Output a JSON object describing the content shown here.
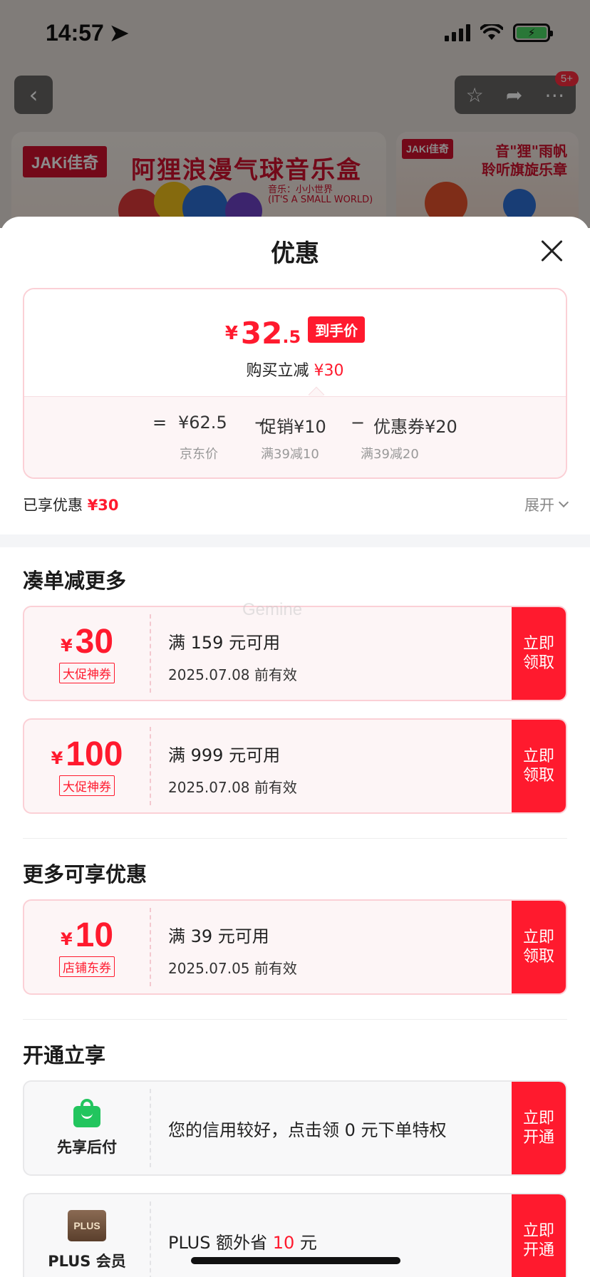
{
  "status": {
    "time": "14:57"
  },
  "background": {
    "badge": "5+",
    "banner_logo": "JAKi佳奇",
    "banner_title": "阿狸浪漫气球音乐盒",
    "banner_music": "音乐：小小世界",
    "banner_eng": "(IT'S A SMALL WORLD)",
    "side_logo": "JAKi佳奇",
    "side_title_1": "音\"狸\"雨帆",
    "side_title_2": "聆听旗旋乐章"
  },
  "sheet": {
    "title": "优惠",
    "price": {
      "currency": "¥",
      "integer": "32",
      "decimal": ".5",
      "tag": "到手价",
      "sub_label": "购买立减",
      "sub_value": "¥30"
    },
    "formula": {
      "equals": "=",
      "jd_price": "¥62.5",
      "minus1": "−",
      "promo": "促销¥10",
      "minus2": "−",
      "coupon": "优惠券¥20",
      "jd_label": "京东价",
      "promo_label": "满39减10",
      "coupon_label": "满39减20"
    },
    "enjoyed": {
      "label": "已享优惠",
      "value": "¥30",
      "expand": "展开"
    },
    "watermark": "Gemine",
    "section1": {
      "title": "凑单减更多",
      "coupons": [
        {
          "currency": "¥",
          "amount": "30",
          "type": "大促神券",
          "condition": "满 159 元可用",
          "expiry": "2025.07.08 前有效",
          "button": "立即领取"
        },
        {
          "currency": "¥",
          "amount": "100",
          "type": "大促神券",
          "condition": "满 999 元可用",
          "expiry": "2025.07.08 前有效",
          "button": "立即领取"
        }
      ]
    },
    "section2": {
      "title": "更多可享优惠",
      "coupons": [
        {
          "currency": "¥",
          "amount": "10",
          "type": "店铺东券",
          "condition": "满 39 元可用",
          "expiry": "2025.07.05 前有效",
          "button": "立即领取"
        }
      ]
    },
    "section3": {
      "title": "开通立享",
      "items": [
        {
          "label": "先享后付",
          "text": "您的信用较好，点击领 0 元下单特权",
          "button": "立即开通"
        },
        {
          "icon_text": "PLUS",
          "label": "PLUS 会员",
          "text_before": "PLUS 额外省 ",
          "text_red": "10",
          "text_after": " 元",
          "button": "立即开通"
        }
      ]
    }
  },
  "colors": {
    "accent": "#ff1a2e",
    "coupon_bg": "#fdf5f6",
    "coupon_border": "#fbd0d6",
    "green": "#22c55e"
  }
}
